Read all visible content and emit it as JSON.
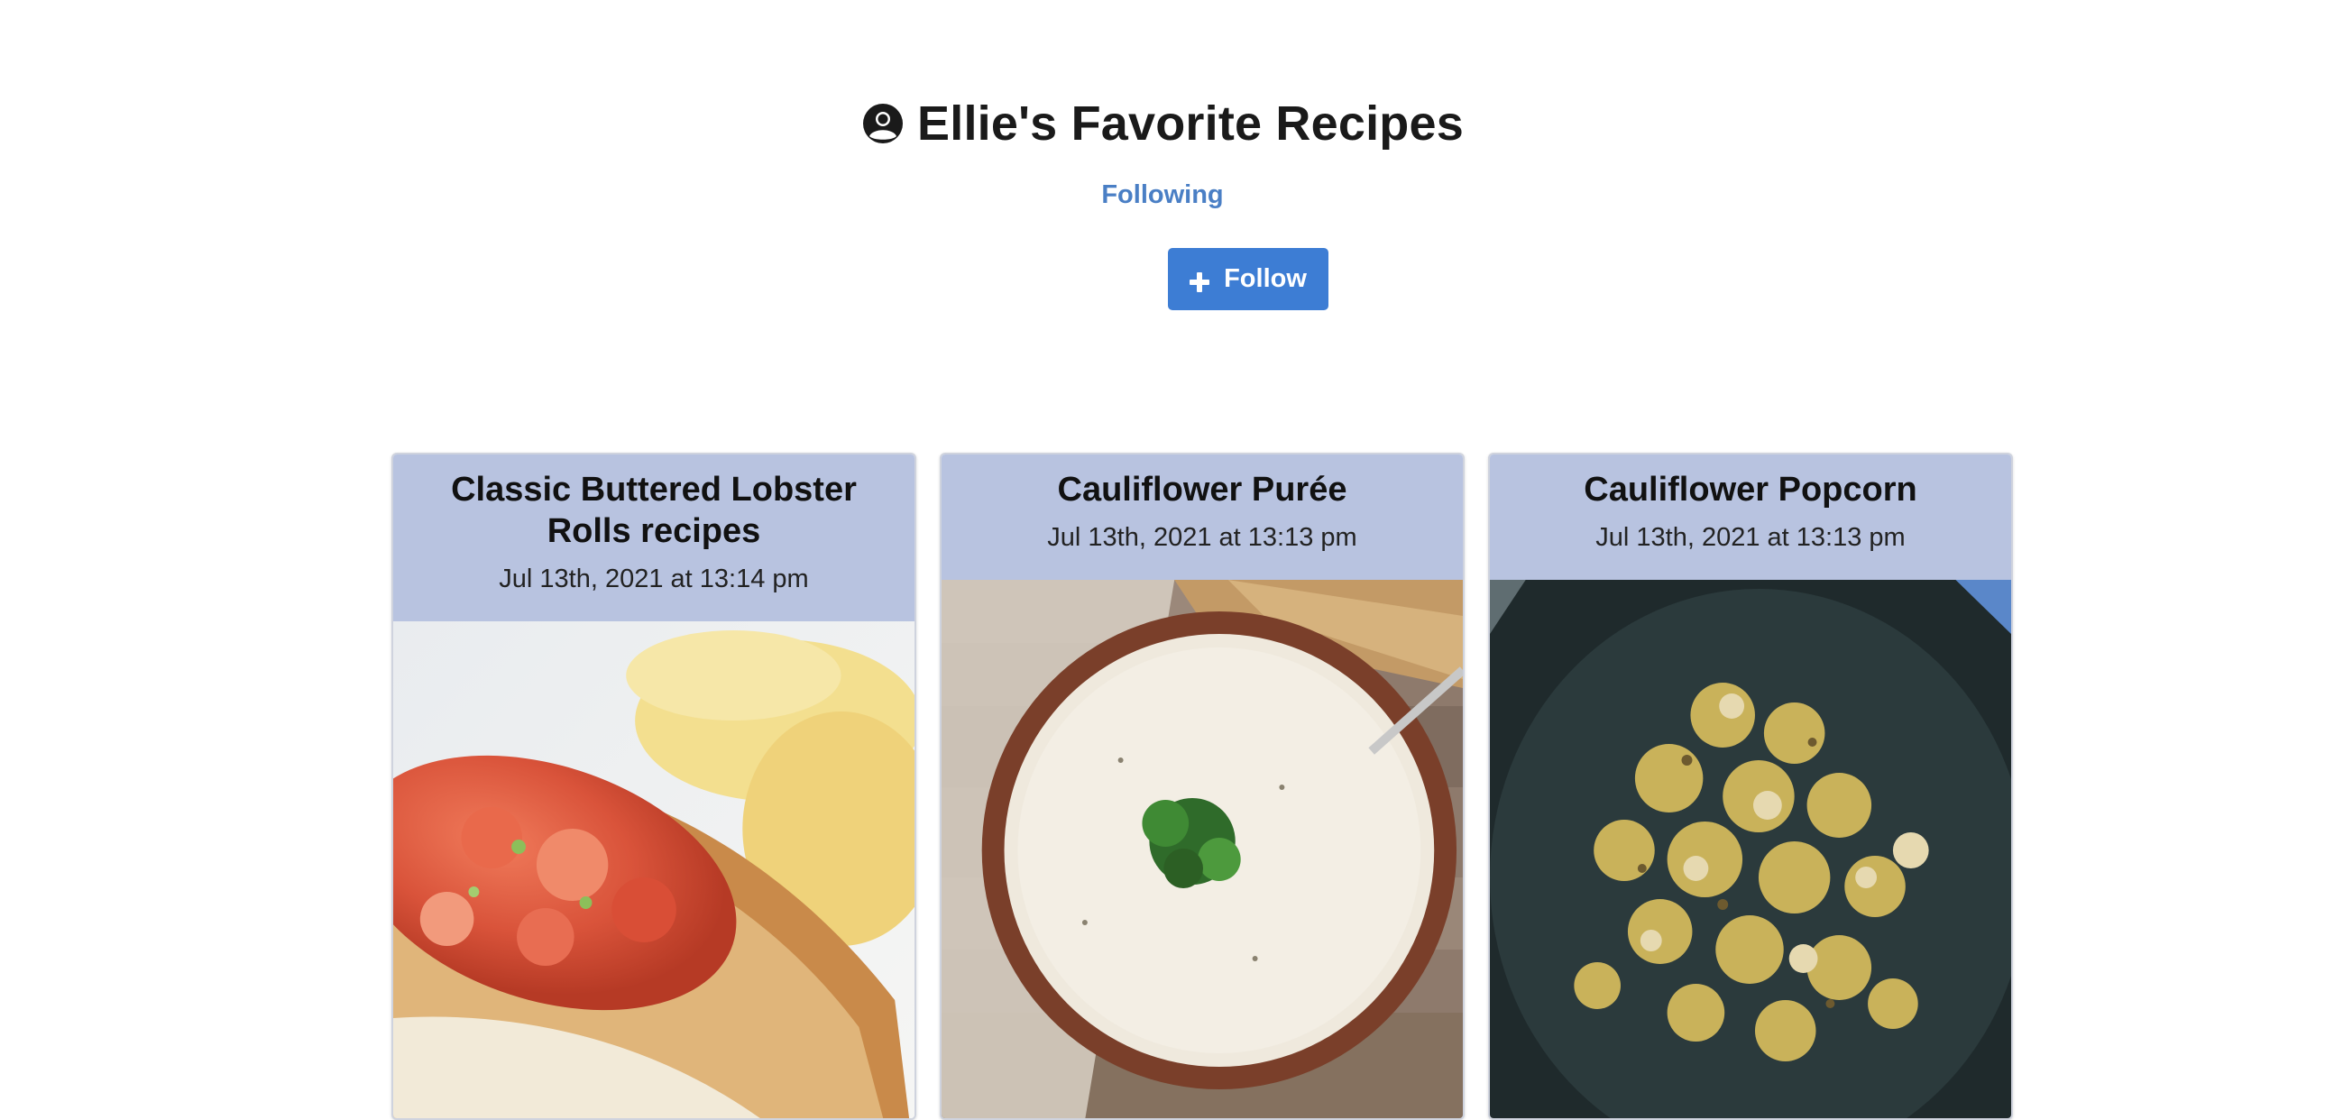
{
  "profile": {
    "title": "Ellie's Favorite Recipes",
    "following_label": "Following",
    "follow_button_label": "Follow"
  },
  "recipes": [
    {
      "title": "Classic Buttered Lobster Rolls recipes",
      "date": "Jul 13th, 2021 at 13:14 pm",
      "image": "lobster-roll-photo"
    },
    {
      "title": "Cauliflower Purée",
      "date": "Jul 13th, 2021 at 13:13 pm",
      "image": "cauliflower-soup-photo"
    },
    {
      "title": "Cauliflower Popcorn",
      "date": "Jul 13th, 2021 at 13:13 pm",
      "image": "roasted-cauliflower-photo"
    }
  ],
  "colors": {
    "accent": "#3d7dd4",
    "link": "#4a7fc5",
    "card_header": "#b8c3e0"
  }
}
